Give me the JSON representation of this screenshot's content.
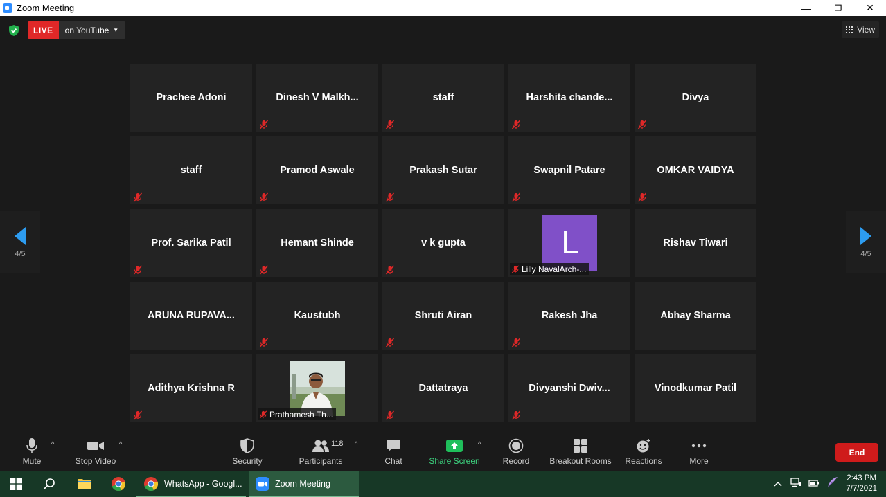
{
  "window": {
    "title": "Zoom Meeting",
    "minimize_glyph": "—",
    "maximize_glyph": "❐",
    "close_glyph": "✕"
  },
  "topbar": {
    "live_label": "LIVE",
    "live_target": "on YouTube",
    "view_label": "View"
  },
  "pagination": {
    "left_counter": "4/5",
    "right_counter": "4/5"
  },
  "participants_grid": [
    {
      "name": "Prachee Adoni",
      "muted": false
    },
    {
      "name": "Dinesh  V  Malkh...",
      "muted": true
    },
    {
      "name": "staff",
      "muted": true
    },
    {
      "name": "Harshita  chande...",
      "muted": true
    },
    {
      "name": "Divya",
      "muted": true
    },
    {
      "name": "staff",
      "muted": true
    },
    {
      "name": "Pramod Aswale",
      "muted": true
    },
    {
      "name": "Prakash Sutar",
      "muted": true
    },
    {
      "name": "Swapnil Patare",
      "muted": true
    },
    {
      "name": "OMKAR VAIDYA",
      "muted": true
    },
    {
      "name": "Prof. Sarika Patil",
      "muted": true
    },
    {
      "name": "Hemant Shinde",
      "muted": true
    },
    {
      "name": "v k gupta",
      "muted": true
    },
    {
      "name": "Lilly NavalArch-...",
      "muted": true,
      "avatar_letter": "L",
      "avatar_color": "#8050c8"
    },
    {
      "name": "Rishav Tiwari",
      "muted": false
    },
    {
      "name": "ARUNA RUPAVA...",
      "muted": false
    },
    {
      "name": "Kaustubh",
      "muted": true
    },
    {
      "name": "Shruti Airan",
      "muted": true
    },
    {
      "name": "Rakesh Jha",
      "muted": true
    },
    {
      "name": "Abhay Sharma",
      "muted": false
    },
    {
      "name": "Adithya Krishna R",
      "muted": true
    },
    {
      "name": "Prathamesh Th...",
      "muted": true,
      "photo": true
    },
    {
      "name": "Dattatraya",
      "muted": true
    },
    {
      "name": "Divyanshi  Dwiv...",
      "muted": true
    },
    {
      "name": "Vinodkumar Patil",
      "muted": false
    }
  ],
  "toolbar": {
    "mute_label": "Mute",
    "stop_video_label": "Stop Video",
    "security_label": "Security",
    "participants_label": "Participants",
    "participants_count": "118",
    "chat_label": "Chat",
    "share_screen_label": "Share Screen",
    "record_label": "Record",
    "breakout_rooms_label": "Breakout Rooms",
    "reactions_label": "Reactions",
    "more_label": "More",
    "end_label": "End"
  },
  "taskbar": {
    "apps": [
      {
        "label": "WhatsApp - Googl..."
      },
      {
        "label": "Zoom Meeting"
      }
    ],
    "time": "2:43 PM",
    "date": "7/7/2021"
  },
  "colors": {
    "live_red": "#e02828",
    "end_red": "#cf1b1b",
    "share_green": "#3dd37f",
    "arrow_blue": "#2d9cf0",
    "taskbar_green": "#173826"
  }
}
